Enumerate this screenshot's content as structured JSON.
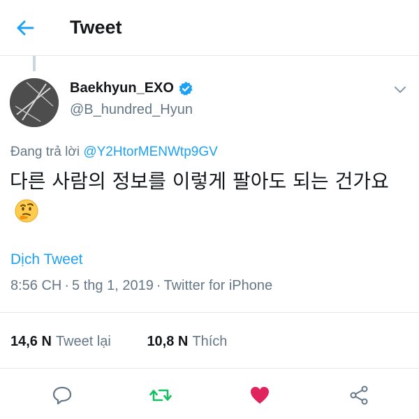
{
  "header": {
    "title": "Tweet",
    "back_icon": "arrow-left-icon"
  },
  "user": {
    "display_name": "Baekhyun_EXO",
    "handle": "@B_hundred_Hyun",
    "verified": true
  },
  "tweet": {
    "reply_prefix": "Đang trả lời",
    "reply_to": "@Y2HtorMENWtp9GV",
    "text": "다른 사람의 정보를 이렇게 팔아도 되는 건가요",
    "emoji": "thinking-face-emoji",
    "translate_label": "Dịch Tweet",
    "time": "8:56 CH",
    "date": "5 thg 1, 2019",
    "source": "Twitter for iPhone",
    "separator": "·"
  },
  "stats": {
    "retweets_count": "14,6 N",
    "retweets_label": "Tweet lại",
    "likes_count": "10,8 N",
    "likes_label": "Thích"
  },
  "colors": {
    "accent": "#1da1f2",
    "retweet": "#17bf63",
    "like": "#e0245e",
    "muted": "#657786"
  }
}
